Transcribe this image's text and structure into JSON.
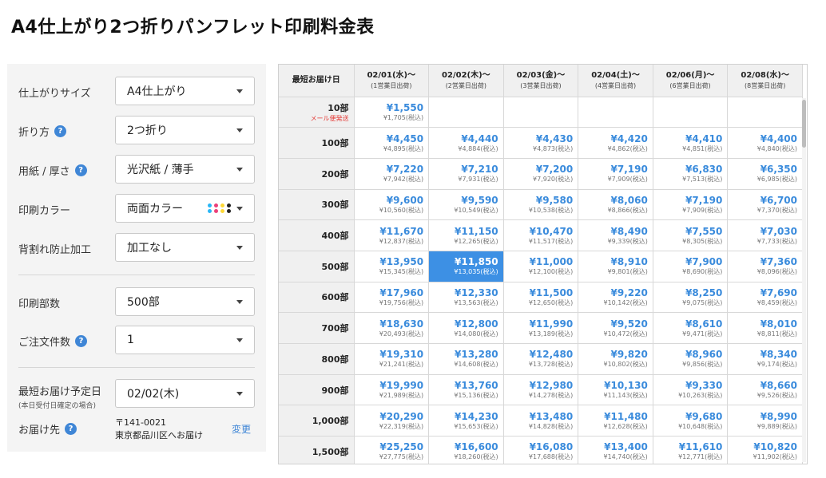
{
  "page": {
    "title": "A4仕上がり2つ折りパンフレット印刷料金表"
  },
  "options": {
    "size": {
      "label": "仕上がりサイズ",
      "value": "A4仕上がり"
    },
    "fold": {
      "label": "折り方",
      "value": "2つ折り"
    },
    "paper": {
      "label": "用紙 / 厚さ",
      "value": "光沢紙 / 薄手"
    },
    "color": {
      "label": "印刷カラー",
      "value": "両面カラー"
    },
    "spine": {
      "label": "背割れ防止加工",
      "value": "加工なし"
    },
    "copies": {
      "label": "印刷部数",
      "value": "500部"
    },
    "orders": {
      "label": "ご注文件数",
      "value": "1"
    },
    "delivery": {
      "label": "最短お届け予定日",
      "sub_label": "(本日受付日確定の場合)",
      "value": "02/02(木)"
    },
    "destination": {
      "label": "お届け先",
      "postal": "〒141-0021",
      "address": "東京都品川区へお届け",
      "change_label": "変更"
    },
    "ink_colors": [
      "#29b6f6",
      "#ec407a",
      "#fdd835",
      "#212121"
    ],
    "help_glyph": "?"
  },
  "table": {
    "corner_label": "最短お届け日",
    "columns": [
      {
        "date": "02/01(水)〜",
        "note": "(1営業日出荷)"
      },
      {
        "date": "02/02(木)〜",
        "note": "(2営業日出荷)"
      },
      {
        "date": "02/03(金)〜",
        "note": "(3営業日出荷)"
      },
      {
        "date": "02/04(土)〜",
        "note": "(4営業日出荷)"
      },
      {
        "date": "02/06(月)〜",
        "note": "(6営業日出荷)"
      },
      {
        "date": "02/08(水)〜",
        "note": "(8営業日出荷)"
      }
    ],
    "rows": [
      {
        "qty": "10部",
        "note": "メール便発送",
        "cells": [
          {
            "price": "¥1,550",
            "tax": "¥1,705(税込)"
          },
          null,
          null,
          null,
          null,
          null
        ]
      },
      {
        "qty": "100部",
        "cells": [
          {
            "price": "¥4,450",
            "tax": "¥4,895(税込)"
          },
          {
            "price": "¥4,440",
            "tax": "¥4,884(税込)"
          },
          {
            "price": "¥4,430",
            "tax": "¥4,873(税込)"
          },
          {
            "price": "¥4,420",
            "tax": "¥4,862(税込)"
          },
          {
            "price": "¥4,410",
            "tax": "¥4,851(税込)"
          },
          {
            "price": "¥4,400",
            "tax": "¥4,840(税込)"
          }
        ]
      },
      {
        "qty": "200部",
        "cells": [
          {
            "price": "¥7,220",
            "tax": "¥7,942(税込)"
          },
          {
            "price": "¥7,210",
            "tax": "¥7,931(税込)"
          },
          {
            "price": "¥7,200",
            "tax": "¥7,920(税込)"
          },
          {
            "price": "¥7,190",
            "tax": "¥7,909(税込)"
          },
          {
            "price": "¥6,830",
            "tax": "¥7,513(税込)"
          },
          {
            "price": "¥6,350",
            "tax": "¥6,985(税込)"
          }
        ]
      },
      {
        "qty": "300部",
        "cells": [
          {
            "price": "¥9,600",
            "tax": "¥10,560(税込)"
          },
          {
            "price": "¥9,590",
            "tax": "¥10,549(税込)"
          },
          {
            "price": "¥9,580",
            "tax": "¥10,538(税込)"
          },
          {
            "price": "¥8,060",
            "tax": "¥8,866(税込)"
          },
          {
            "price": "¥7,190",
            "tax": "¥7,909(税込)"
          },
          {
            "price": "¥6,700",
            "tax": "¥7,370(税込)"
          }
        ]
      },
      {
        "qty": "400部",
        "cells": [
          {
            "price": "¥11,670",
            "tax": "¥12,837(税込)"
          },
          {
            "price": "¥11,150",
            "tax": "¥12,265(税込)"
          },
          {
            "price": "¥10,470",
            "tax": "¥11,517(税込)"
          },
          {
            "price": "¥8,490",
            "tax": "¥9,339(税込)"
          },
          {
            "price": "¥7,550",
            "tax": "¥8,305(税込)"
          },
          {
            "price": "¥7,030",
            "tax": "¥7,733(税込)"
          }
        ]
      },
      {
        "qty": "500部",
        "cells": [
          {
            "price": "¥13,950",
            "tax": "¥15,345(税込)"
          },
          {
            "price": "¥11,850",
            "tax": "¥13,035(税込)",
            "selected": true
          },
          {
            "price": "¥11,000",
            "tax": "¥12,100(税込)"
          },
          {
            "price": "¥8,910",
            "tax": "¥9,801(税込)"
          },
          {
            "price": "¥7,900",
            "tax": "¥8,690(税込)"
          },
          {
            "price": "¥7,360",
            "tax": "¥8,096(税込)"
          }
        ]
      },
      {
        "qty": "600部",
        "cells": [
          {
            "price": "¥17,960",
            "tax": "¥19,756(税込)"
          },
          {
            "price": "¥12,330",
            "tax": "¥13,563(税込)"
          },
          {
            "price": "¥11,500",
            "tax": "¥12,650(税込)"
          },
          {
            "price": "¥9,220",
            "tax": "¥10,142(税込)"
          },
          {
            "price": "¥8,250",
            "tax": "¥9,075(税込)"
          },
          {
            "price": "¥7,690",
            "tax": "¥8,459(税込)"
          }
        ]
      },
      {
        "qty": "700部",
        "cells": [
          {
            "price": "¥18,630",
            "tax": "¥20,493(税込)"
          },
          {
            "price": "¥12,800",
            "tax": "¥14,080(税込)"
          },
          {
            "price": "¥11,990",
            "tax": "¥13,189(税込)"
          },
          {
            "price": "¥9,520",
            "tax": "¥10,472(税込)"
          },
          {
            "price": "¥8,610",
            "tax": "¥9,471(税込)"
          },
          {
            "price": "¥8,010",
            "tax": "¥8,811(税込)"
          }
        ]
      },
      {
        "qty": "800部",
        "cells": [
          {
            "price": "¥19,310",
            "tax": "¥21,241(税込)"
          },
          {
            "price": "¥13,280",
            "tax": "¥14,608(税込)"
          },
          {
            "price": "¥12,480",
            "tax": "¥13,728(税込)"
          },
          {
            "price": "¥9,820",
            "tax": "¥10,802(税込)"
          },
          {
            "price": "¥8,960",
            "tax": "¥9,856(税込)"
          },
          {
            "price": "¥8,340",
            "tax": "¥9,174(税込)"
          }
        ]
      },
      {
        "qty": "900部",
        "cells": [
          {
            "price": "¥19,990",
            "tax": "¥21,989(税込)"
          },
          {
            "price": "¥13,760",
            "tax": "¥15,136(税込)"
          },
          {
            "price": "¥12,980",
            "tax": "¥14,278(税込)"
          },
          {
            "price": "¥10,130",
            "tax": "¥11,143(税込)"
          },
          {
            "price": "¥9,330",
            "tax": "¥10,263(税込)"
          },
          {
            "price": "¥8,660",
            "tax": "¥9,526(税込)"
          }
        ]
      },
      {
        "qty": "1,000部",
        "cells": [
          {
            "price": "¥20,290",
            "tax": "¥22,319(税込)"
          },
          {
            "price": "¥14,230",
            "tax": "¥15,653(税込)"
          },
          {
            "price": "¥13,480",
            "tax": "¥14,828(税込)"
          },
          {
            "price": "¥11,480",
            "tax": "¥12,628(税込)"
          },
          {
            "price": "¥9,680",
            "tax": "¥10,648(税込)"
          },
          {
            "price": "¥8,990",
            "tax": "¥9,889(税込)"
          }
        ]
      },
      {
        "qty": "1,500部",
        "cells": [
          {
            "price": "¥25,250",
            "tax": "¥27,775(税込)"
          },
          {
            "price": "¥16,600",
            "tax": "¥18,260(税込)"
          },
          {
            "price": "¥16,080",
            "tax": "¥17,688(税込)"
          },
          {
            "price": "¥13,400",
            "tax": "¥14,740(税込)"
          },
          {
            "price": "¥11,610",
            "tax": "¥12,771(税込)"
          },
          {
            "price": "¥10,820",
            "tax": "¥11,902(税込)"
          }
        ]
      }
    ]
  },
  "theme": {
    "accent": "#3a8bdc",
    "selected_bg": "#3d90e4",
    "note_red": "#e53935"
  }
}
